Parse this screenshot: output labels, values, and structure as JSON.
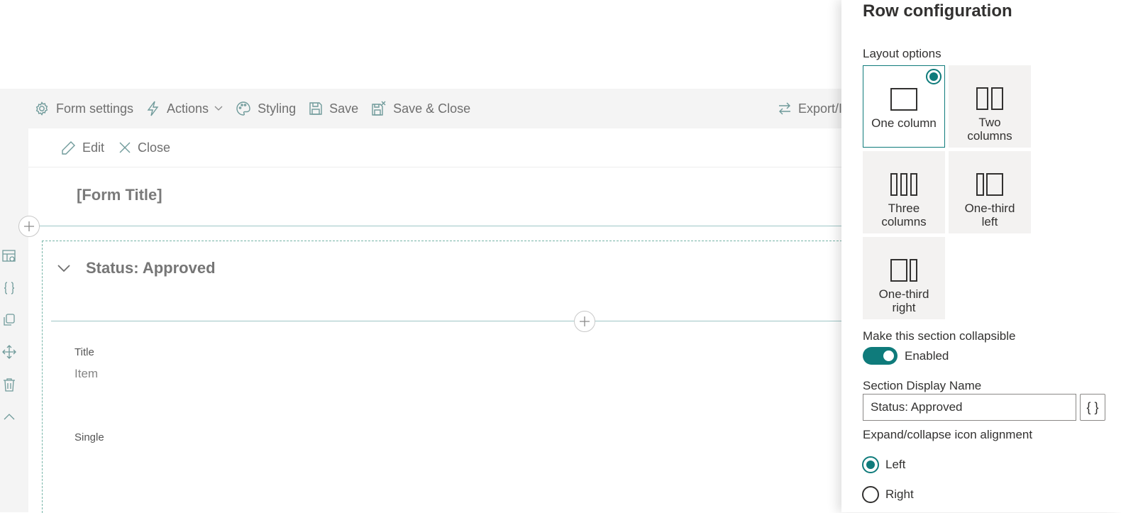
{
  "toolbar": {
    "form_settings": "Form settings",
    "actions": "Actions",
    "styling": "Styling",
    "save": "Save",
    "save_close": "Save & Close",
    "export": "Export/I"
  },
  "command_bar": {
    "edit": "Edit",
    "close": "Close"
  },
  "form": {
    "title": "[Form Title]",
    "section_name": "Status: Approved",
    "fields": [
      {
        "label": "Title",
        "value": "Item"
      },
      {
        "label": "Single",
        "value": ""
      }
    ]
  },
  "rail_icons": [
    "layout-settings-icon",
    "braces-icon",
    "copy-icon",
    "move-icon",
    "delete-icon",
    "chevron-up-icon"
  ],
  "panel": {
    "title": "Row configuration",
    "layout_options_label": "Layout options",
    "layouts": [
      {
        "label": "One column",
        "selected": true,
        "icon": "one-column-icon"
      },
      {
        "label": "Two columns",
        "selected": false,
        "icon": "two-columns-icon"
      },
      {
        "label": "Three columns",
        "selected": false,
        "icon": "three-columns-icon"
      },
      {
        "label": "One-third left",
        "selected": false,
        "icon": "one-third-left-icon"
      },
      {
        "label": "One-third right",
        "selected": false,
        "icon": "one-third-right-icon"
      }
    ],
    "collapsible_label": "Make this section collapsible",
    "collapsible_state": "Enabled",
    "display_name_label": "Section Display Name",
    "display_name_value": "Status: Approved",
    "brace_button": "{ }",
    "alignment_label": "Expand/collapse icon alignment",
    "alignment_options": [
      "Left",
      "Right"
    ],
    "alignment_selected": "Left"
  },
  "colors": {
    "accent": "#0f7b7b",
    "toolbar_bg": "#f4f4f4",
    "tile_bg": "#f3f2f1"
  }
}
